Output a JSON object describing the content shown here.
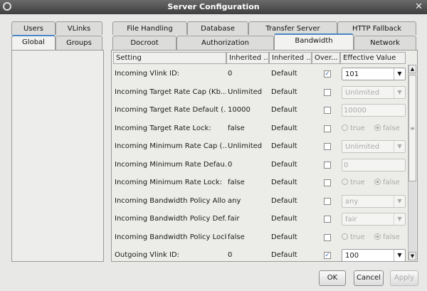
{
  "window": {
    "title": "Server Configuration",
    "close_glyph": "✕"
  },
  "left_tabs": {
    "row1": [
      "Users",
      "VLinks"
    ],
    "row2": [
      "Global",
      "Groups"
    ],
    "active": "Global"
  },
  "right_tabs": {
    "row1": [
      "File Handling",
      "Database",
      "Transfer Server",
      "HTTP Fallback"
    ],
    "row2": [
      "Docroot",
      "Authorization",
      "Bandwidth",
      "Network"
    ],
    "active": "Bandwidth"
  },
  "table": {
    "columns": [
      "Setting",
      "Inherited ...",
      "Inherited ...",
      "Over...",
      "Effective Value"
    ],
    "rows": [
      {
        "setting": "Incoming Vlink ID:",
        "inherited_value": "0",
        "inherited_from": "Default",
        "override": true,
        "widget": "combo",
        "value": "101",
        "enabled": true
      },
      {
        "setting": "Incoming Target Rate Cap (Kb...",
        "inherited_value": "Unlimited",
        "inherited_from": "Default",
        "override": false,
        "widget": "combo",
        "value": "Unlimited",
        "enabled": false
      },
      {
        "setting": "Incoming Target Rate Default (...",
        "inherited_value": "10000",
        "inherited_from": "Default",
        "override": false,
        "widget": "text",
        "value": "10000",
        "enabled": false
      },
      {
        "setting": "Incoming Target Rate Lock:",
        "inherited_value": "false",
        "inherited_from": "Default",
        "override": false,
        "widget": "radio",
        "true_label": "true",
        "false_label": "false",
        "value": "false",
        "enabled": false
      },
      {
        "setting": "Incoming Minimum Rate Cap (...",
        "inherited_value": "Unlimited",
        "inherited_from": "Default",
        "override": false,
        "widget": "combo",
        "value": "Unlimited",
        "enabled": false
      },
      {
        "setting": "Incoming Minimum Rate Defau...",
        "inherited_value": "0",
        "inherited_from": "Default",
        "override": false,
        "widget": "text",
        "value": "0",
        "enabled": false
      },
      {
        "setting": "Incoming Minimum Rate Lock:",
        "inherited_value": "false",
        "inherited_from": "Default",
        "override": false,
        "widget": "radio",
        "true_label": "true",
        "false_label": "false",
        "value": "false",
        "enabled": false
      },
      {
        "setting": "Incoming Bandwidth Policy Allo...",
        "inherited_value": "any",
        "inherited_from": "Default",
        "override": false,
        "widget": "combo",
        "value": "any",
        "enabled": false
      },
      {
        "setting": "Incoming Bandwidth Policy Def...",
        "inherited_value": "fair",
        "inherited_from": "Default",
        "override": false,
        "widget": "combo",
        "value": "fair",
        "enabled": false
      },
      {
        "setting": "Incoming Bandwidth Policy Lock:",
        "inherited_value": "false",
        "inherited_from": "Default",
        "override": false,
        "widget": "radio",
        "true_label": "true",
        "false_label": "false",
        "value": "false",
        "enabled": false
      },
      {
        "setting": "Outgoing Vlink ID:",
        "inherited_value": "0",
        "inherited_from": "Default",
        "override": true,
        "widget": "combo",
        "value": "100",
        "enabled": true
      }
    ]
  },
  "buttons": {
    "ok": "OK",
    "cancel": "Cancel",
    "apply": "Apply"
  },
  "colors": {
    "accent": "#4c86c6",
    "titlebar": "#4a4a4a"
  }
}
